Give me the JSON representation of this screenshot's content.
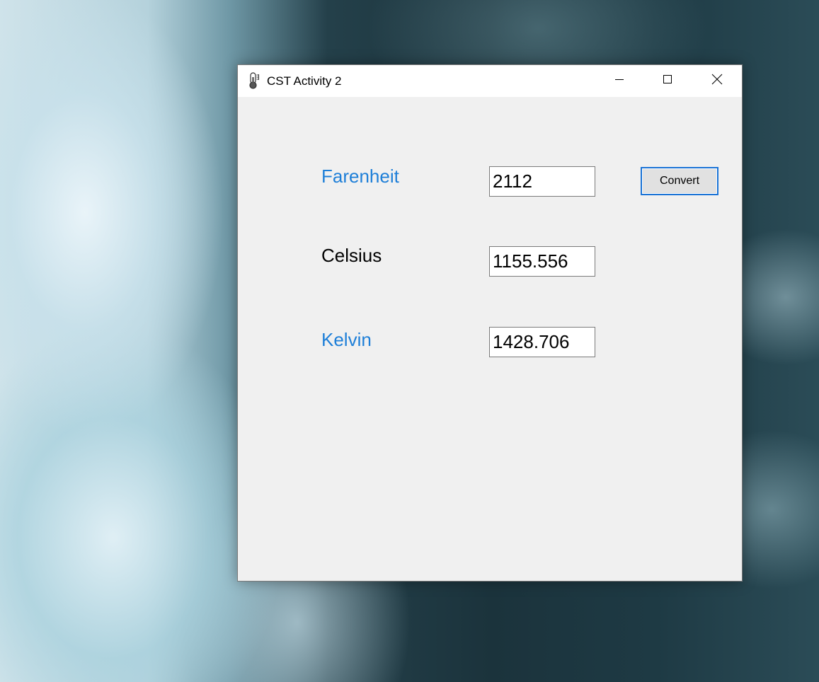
{
  "window": {
    "title": "CST Activity 2",
    "icon": "thermometer-icon"
  },
  "caption_buttons": {
    "minimize": "minimize-icon",
    "maximize": "maximize-icon",
    "close": "close-icon"
  },
  "form": {
    "fahrenheit_label": "Farenheit",
    "fahrenheit_value": "2112",
    "celsius_label": "Celsius",
    "celsius_value": "1155.556",
    "kelvin_label": "Kelvin",
    "kelvin_value": "1428.706",
    "convert_label": "Convert"
  },
  "colors": {
    "label_blue": "#1e7fd8",
    "label_black": "#000000",
    "button_focus_border": "#1a73d6",
    "form_background": "#f0f0f0"
  }
}
